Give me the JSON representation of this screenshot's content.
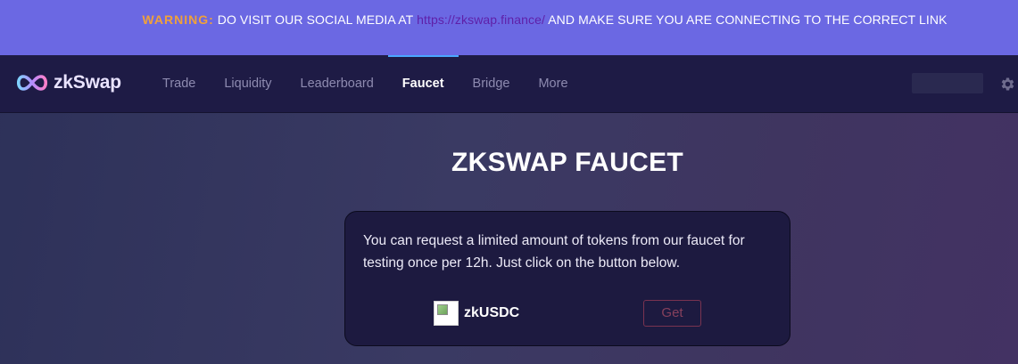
{
  "banner": {
    "warning_label": "WARNING:",
    "text_before": " DO VISIT OUR SOCIAL MEDIA AT ",
    "link_text": "https://zkswap.finance/",
    "text_after": " AND MAKE SURE YOU ARE CONNECTING TO THE CORRECT LINK"
  },
  "header": {
    "logo_text": "zkSwap",
    "nav": [
      {
        "label": "Trade"
      },
      {
        "label": "Liquidity"
      },
      {
        "label": "Leaderboard"
      },
      {
        "label": "Faucet",
        "active": true
      },
      {
        "label": "Bridge"
      },
      {
        "label": "More"
      }
    ]
  },
  "main": {
    "title": "ZKSWAP FAUCET",
    "description": "You can request a limited amount of tokens from our faucet for testing once per 12h. Just click on the button below.",
    "token": {
      "symbol": "zkUSDC",
      "button_label": "Get"
    }
  },
  "colors": {
    "banner_bg": "#6b68e3",
    "warning": "#f0a13a",
    "link": "#5f1fa8",
    "nav_bg": "#1e1b45",
    "active_indicator": "#4aa8ff",
    "card_bg": "#1d1a40",
    "get_button": "#86405c"
  },
  "icons": {
    "logo": "infinity-logo-icon",
    "settings": "gear-icon",
    "token": "broken-image-icon"
  }
}
